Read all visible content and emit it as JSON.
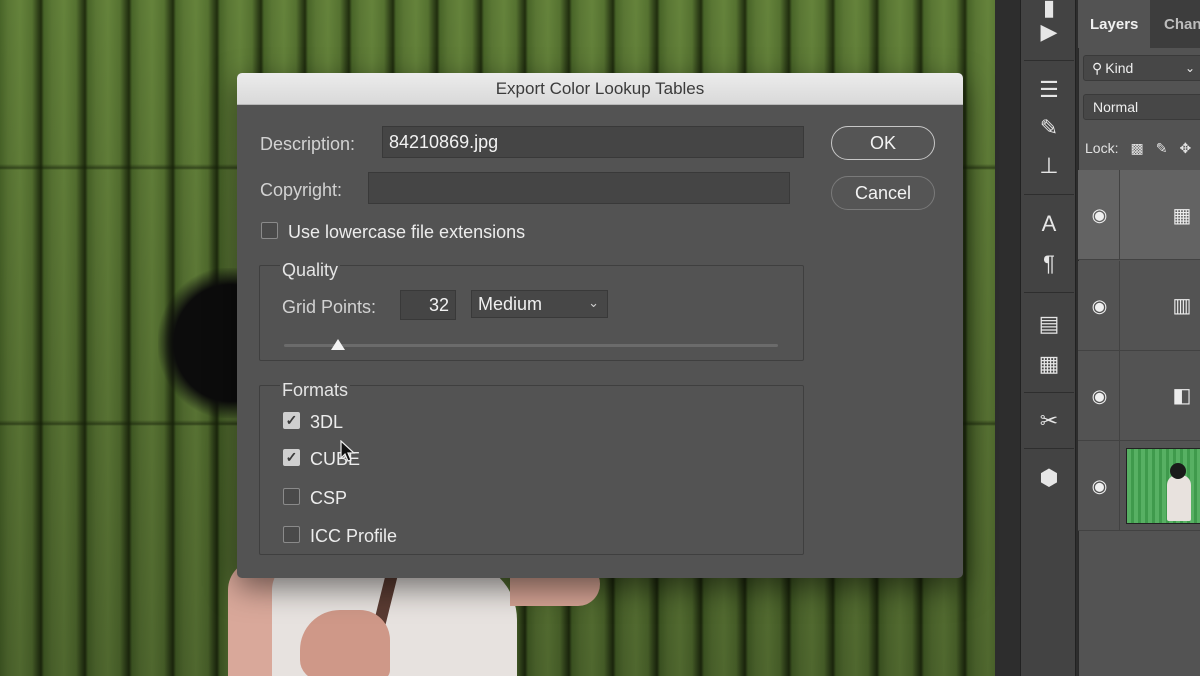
{
  "dialog": {
    "title": "Export Color Lookup Tables",
    "description_label": "Description:",
    "description_value": "84210869.jpg",
    "copyright_label": "Copyright:",
    "copyright_value": "",
    "lowercase_label": "Use lowercase file extensions",
    "lowercase_checked": false,
    "ok_label": "OK",
    "cancel_label": "Cancel",
    "quality": {
      "title": "Quality",
      "grid_points_label": "Grid Points:",
      "grid_points_value": "32",
      "preset_value": "Medium",
      "slider_fraction": 0.11
    },
    "formats": {
      "title": "Formats",
      "items": [
        {
          "label": "3DL",
          "checked": true
        },
        {
          "label": "CUBE",
          "checked": true
        },
        {
          "label": "CSP",
          "checked": false
        },
        {
          "label": "ICC Profile",
          "checked": false
        }
      ]
    }
  },
  "layers_panel": {
    "tabs": [
      "Layers",
      "Chan"
    ],
    "kind_label": "Kind",
    "blend_mode": "Normal",
    "lock_label": "Lock:"
  },
  "colors": {
    "dialog_bg": "#535353",
    "titlebar_bg": "#dcdcdc",
    "panel_bg": "#535353"
  }
}
